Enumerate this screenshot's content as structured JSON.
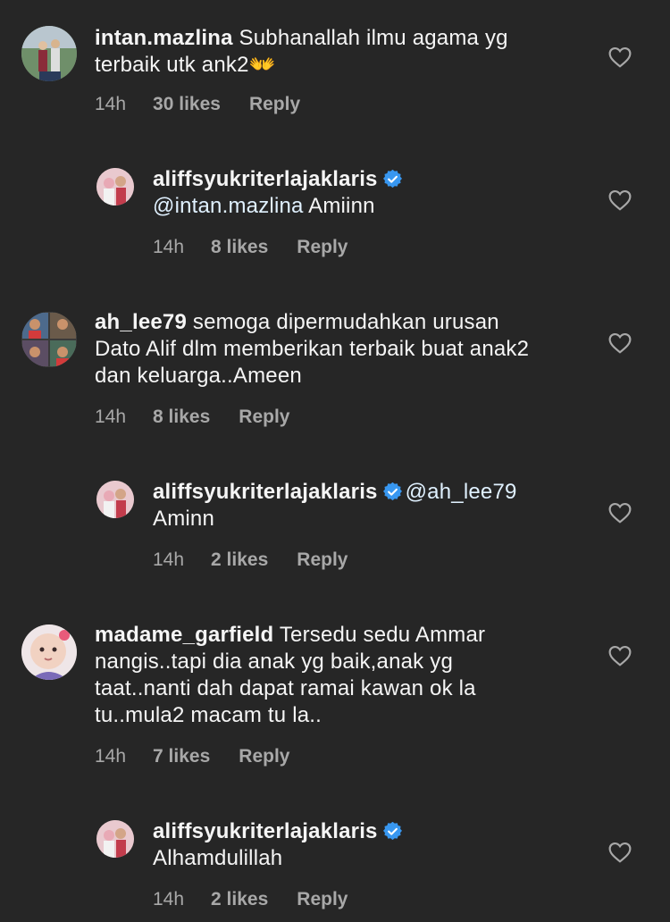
{
  "comments": [
    {
      "username": "intan.mazlina",
      "text": "Subhanallah ilmu agama yg terbaik utk ank2👐",
      "time": "14h",
      "likes": "30 likes",
      "reply": "Reply"
    },
    {
      "username": "aliffsyukriterlajaklaris",
      "mention": "@intan.mazlina",
      "text": " Amiinn",
      "time": "14h",
      "likes": "8 likes",
      "reply": "Reply"
    },
    {
      "username": "ah_lee79",
      "text": "semoga dipermudahkan urusan Dato Alif dlm memberikan terbaik buat anak2 dan keluarga..Ameen",
      "time": "14h",
      "likes": "8 likes",
      "reply": "Reply"
    },
    {
      "username": "aliffsyukriterlajaklaris",
      "mention": "@ah_lee79",
      "text": "Aminn",
      "time": "14h",
      "likes": "2 likes",
      "reply": "Reply"
    },
    {
      "username": "madame_garfield",
      "text": "Tersedu sedu Ammar nangis..tapi dia anak yg baik,anak yg taat..nanti dah dapat ramai kawan ok la tu..mula2 macam tu la..",
      "time": "14h",
      "likes": "7 likes",
      "reply": "Reply"
    },
    {
      "username": "aliffsyukriterlajaklaris",
      "text": "Alhamdulillah",
      "time": "14h",
      "likes": "2 likes",
      "reply": "Reply"
    }
  ],
  "colors": {
    "background": "#262626",
    "text": "#f5f5f5",
    "meta": "#a8a8a8",
    "verified": "#3897f0"
  },
  "icons": {
    "like": "heart-outline-icon",
    "verified": "verified-badge-icon"
  }
}
